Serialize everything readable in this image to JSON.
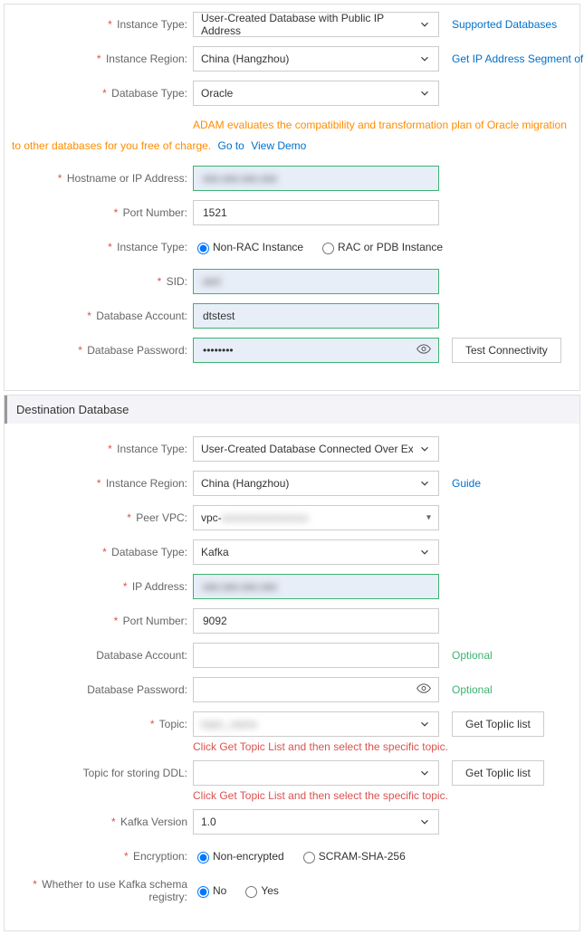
{
  "source": {
    "instance_type_label": "Instance Type:",
    "instance_type_value": "User-Created Database with Public IP Address",
    "supported_databases": "Supported Databases",
    "instance_region_label": "Instance Region:",
    "instance_region_value": "China (Hangzhou)",
    "get_ip_segment": "Get IP Address Segment of DTS",
    "database_type_label": "Database Type:",
    "database_type_value": "Oracle",
    "adam_note": "ADAM evaluates the compatibility and transformation plan of Oracle migration to other databases for you free of charge.",
    "adam_goto": "Go to",
    "adam_viewdemo": "View Demo",
    "hostname_label": "Hostname or IP Address:",
    "hostname_value": "xxx.xxx.xxx.xxx",
    "port_label": "Port Number:",
    "port_value": "1521",
    "instance_type2_label": "Instance Type:",
    "radio_nonrac": "Non-RAC Instance",
    "radio_rac": "RAC or PDB Instance",
    "sid_label": "SID:",
    "sid_value": "orcl",
    "db_account_label": "Database Account:",
    "db_account_value": "dtstest",
    "db_password_label": "Database Password:",
    "db_password_value": "••••••••",
    "test_btn": "Test Connectivity"
  },
  "dest": {
    "section_title": "Destination Database",
    "instance_type_label": "Instance Type:",
    "instance_type_value": "User-Created Database Connected Over Express Connect, VPN Ga",
    "instance_region_label": "Instance Region:",
    "instance_region_value": "China (Hangzhou)",
    "guide": "Guide",
    "peer_vpc_label": "Peer VPC:",
    "peer_vpc_value": "vpc-xxxxxxxxxxxxxxxx",
    "database_type_label": "Database Type:",
    "database_type_value": "Kafka",
    "ip_label": "IP Address:",
    "ip_value": "xxx.xxx.xxx.xxx",
    "port_label": "Port Number:",
    "port_value": "9092",
    "db_account_label": "Database Account:",
    "db_password_label": "Database Password:",
    "optional": "Optional",
    "topic_label": "Topic:",
    "topic_value": "topic_name",
    "topic_hint": "Click Get Topic List and then select the specific topic.",
    "get_topic_btn": "Get TopIic list",
    "topic_ddl_label": "Topic for storing DDL:",
    "kafka_version_label": "Kafka Version",
    "kafka_version_value": "1.0",
    "encryption_label": "Encryption:",
    "enc_non": "Non-encrypted",
    "enc_scram": "SCRAM-SHA-256",
    "schema_registry_label": "Whether to use Kafka schema registry:",
    "no": "No",
    "yes": "Yes"
  }
}
